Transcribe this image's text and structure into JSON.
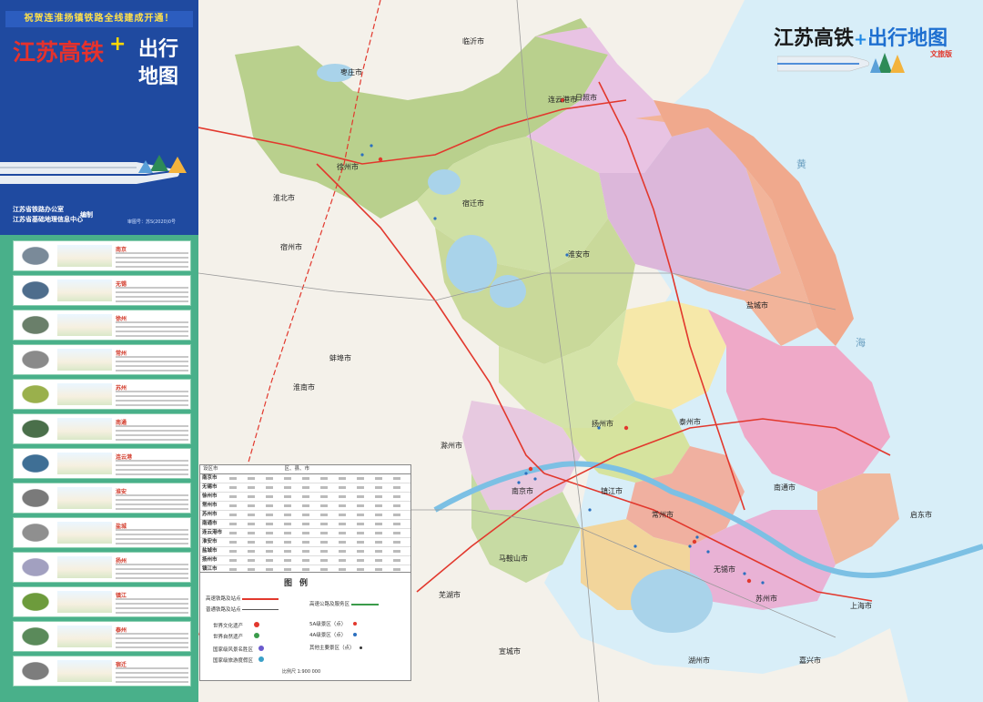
{
  "cover": {
    "banner": "祝贺连淮扬镇铁路全线建成开通！",
    "title_line1": "江苏高铁",
    "plus": "+",
    "title_line2": "出行地图",
    "publisher1": "江苏省铁路办公室",
    "publisher2": "江苏省基础地理信息中心",
    "publisher_mark": "编制",
    "approval": "审图号：苏S(2020)0号"
  },
  "header": {
    "title": "江苏高铁",
    "plus": "+",
    "title_blue": "出行地图",
    "edition": "文旅版"
  },
  "cards": [
    {
      "city": "南京"
    },
    {
      "city": "无锡"
    },
    {
      "city": "徐州"
    },
    {
      "city": "常州"
    },
    {
      "city": "苏州"
    },
    {
      "city": "南通"
    },
    {
      "city": "连云港"
    },
    {
      "city": "淮安"
    },
    {
      "city": "盐城"
    },
    {
      "city": "扬州"
    },
    {
      "city": "镇江"
    },
    {
      "city": "泰州"
    },
    {
      "city": "宿迁"
    }
  ],
  "places": {
    "linyi": "临沂市",
    "rizhao": "日照市",
    "zaozhuang": "枣庄市",
    "lianyungang": "连云港市",
    "xuzhou": "徐州市",
    "suqian": "宿迁市",
    "huaibei": "淮北市",
    "suzhou_ah": "宿州市",
    "bengbu": "蚌埠市",
    "huainan": "淮南市",
    "chuzhou": "滁州市",
    "yangzhou": "扬州市",
    "taizhou": "泰州市",
    "nanjing": "南京市",
    "zhenjiang": "镇江市",
    "changzhou": "常州市",
    "wuxi": "无锡市",
    "suzhou": "苏州市",
    "shanghai": "上海市",
    "nantong": "南通市",
    "wuhu": "芜湖市",
    "ma_anshan": "马鞍山市",
    "xuancheng": "宣城市",
    "huzhou": "湖州市",
    "jiaxing": "嘉兴市",
    "qidong": "启东市",
    "yancheng": "盐城市",
    "huaian": "淮安市",
    "sea_huang": "黄",
    "sea_hai": "海"
  },
  "table": {
    "col1": "设区市",
    "col2": "区、县、市",
    "rows": [
      "南京市",
      "无锡市",
      "徐州市",
      "常州市",
      "苏州市",
      "南通市",
      "连云港市",
      "淮安市",
      "盐城市",
      "扬州市",
      "镇江市",
      "泰州市",
      "宿迁市"
    ]
  },
  "legend": {
    "title": "图例",
    "hsr_station": "高速铁路及站点",
    "rail_station": "普通铁路及站点",
    "expressway": "高速公路及服务区",
    "world_culture": "世界文化遗产",
    "world_nature": "世界自然遗产",
    "aaaaa": "5A级景区（点）",
    "aaaa": "4A级景区（点）",
    "scenic": "国家级风景名胜区",
    "resort": "国家级旅游度假区",
    "other": "其他主要景区（点）",
    "scale": "比例尺 1:900 000"
  },
  "colors": {
    "cover_blue": "#1f4aa0",
    "panel_green": "#49b08a",
    "sea": "#d8eef8",
    "hsr_red": "#e2382d"
  }
}
